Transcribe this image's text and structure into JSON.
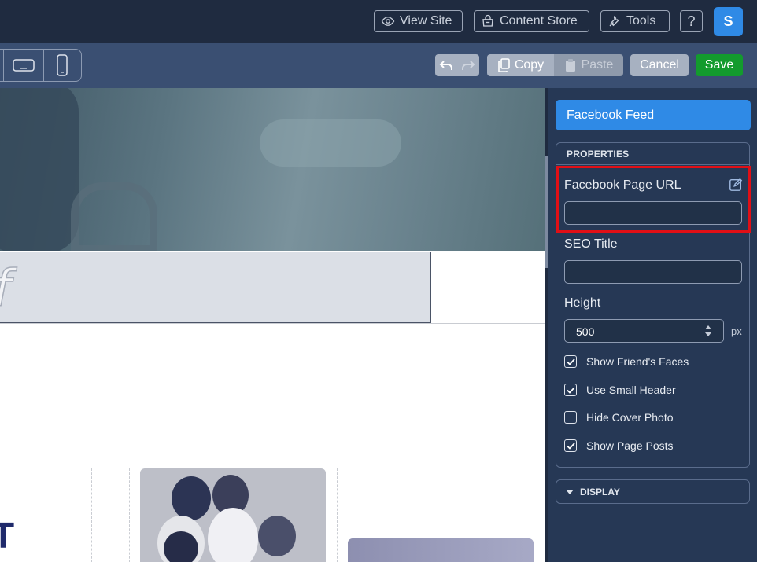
{
  "topbar": {
    "view_site": "View Site",
    "content_store": "Content Store",
    "tools": "Tools",
    "help": "?",
    "avatar": "S"
  },
  "toolbar": {
    "copy": "Copy",
    "paste": "Paste",
    "cancel": "Cancel",
    "save": "Save"
  },
  "canvas": {
    "fb_glyph": "f",
    "big_letter": "T"
  },
  "panel": {
    "widget_title": "Facebook Feed",
    "properties_title": "PROPERTIES",
    "fields": {
      "url_label": "Facebook Page URL",
      "url_value": "",
      "seo_label": "SEO Title",
      "seo_value": "",
      "height_label": "Height",
      "height_value": "500",
      "height_unit": "px"
    },
    "options": [
      {
        "label": "Show Friend's Faces",
        "checked": true
      },
      {
        "label": "Use Small Header",
        "checked": true
      },
      {
        "label": "Hide Cover Photo",
        "checked": false
      },
      {
        "label": "Show Page Posts",
        "checked": true
      }
    ],
    "display_title": "DISPLAY"
  },
  "colors": {
    "accent": "#2f8ae6",
    "save": "#139b2d",
    "highlight": "#e10f16",
    "panel_bg": "#263855"
  }
}
